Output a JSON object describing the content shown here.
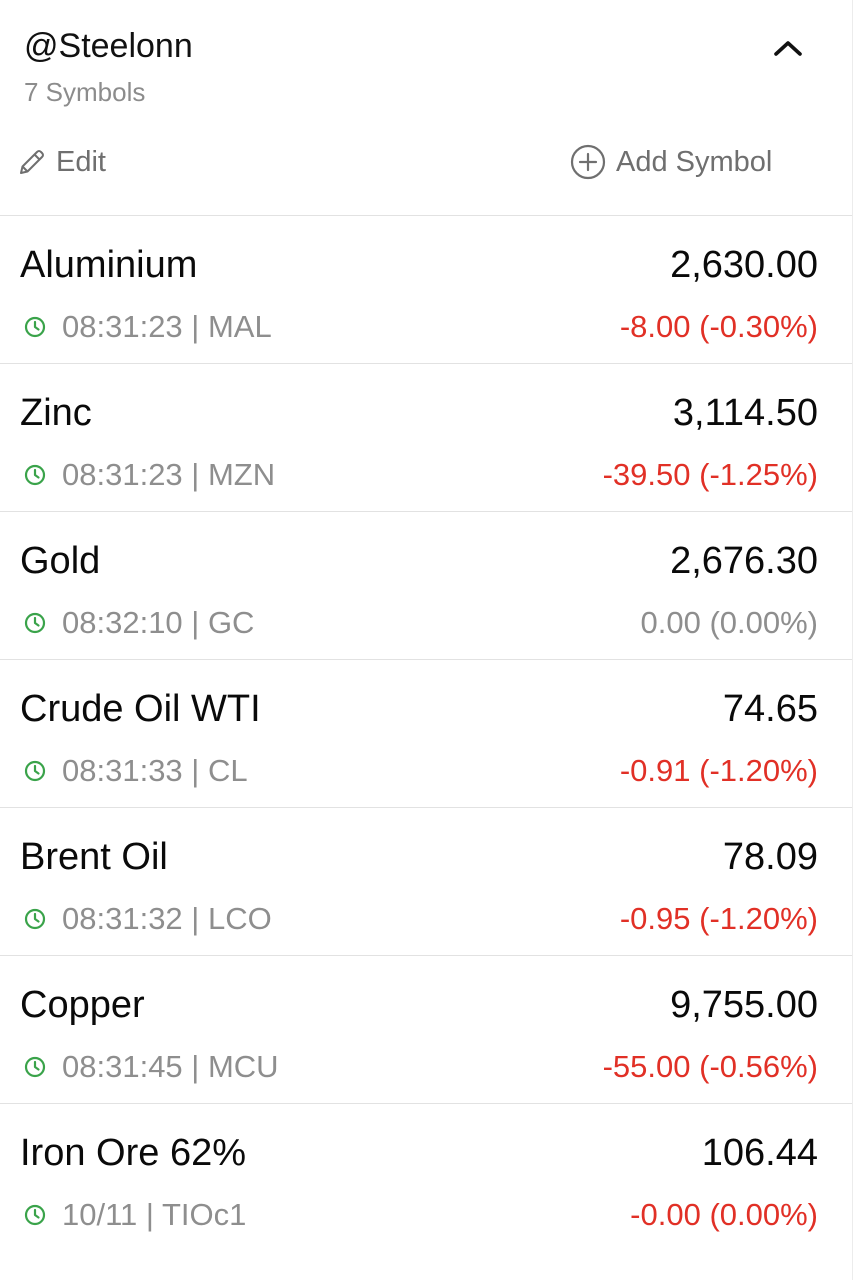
{
  "header": {
    "list_name": "@Steelonn",
    "symbol_count": "7 Symbols",
    "edit_label": "Edit",
    "add_label": "Add Symbol"
  },
  "colors": {
    "down": "#e13026",
    "flat": "#8e8e8e",
    "clock": "#3aa34a"
  },
  "icons": {
    "collapse": "chevron-up-icon",
    "edit": "pencil-icon",
    "add": "plus-circle-icon",
    "time": "clock-icon"
  },
  "rows": [
    {
      "name": "Aluminium",
      "price": "2,630.00",
      "meta": "08:31:23 | MAL",
      "change": "-8.00 (-0.30%)",
      "direction": "down"
    },
    {
      "name": "Zinc",
      "price": "3,114.50",
      "meta": "08:31:23 | MZN",
      "change": "-39.50 (-1.25%)",
      "direction": "down"
    },
    {
      "name": "Gold",
      "price": "2,676.30",
      "meta": "08:32:10 | GC",
      "change": "0.00 (0.00%)",
      "direction": "flat"
    },
    {
      "name": "Crude Oil WTI",
      "price": "74.65",
      "meta": "08:31:33 | CL",
      "change": "-0.91 (-1.20%)",
      "direction": "down"
    },
    {
      "name": "Brent Oil",
      "price": "78.09",
      "meta": "08:31:32 | LCO",
      "change": "-0.95 (-1.20%)",
      "direction": "down"
    },
    {
      "name": "Copper",
      "price": "9,755.00",
      "meta": "08:31:45 | MCU",
      "change": "-55.00 (-0.56%)",
      "direction": "down"
    },
    {
      "name": "Iron Ore 62%",
      "price": "106.44",
      "meta": "10/11 | TIOc1",
      "change": "-0.00 (0.00%)",
      "direction": "down"
    }
  ]
}
